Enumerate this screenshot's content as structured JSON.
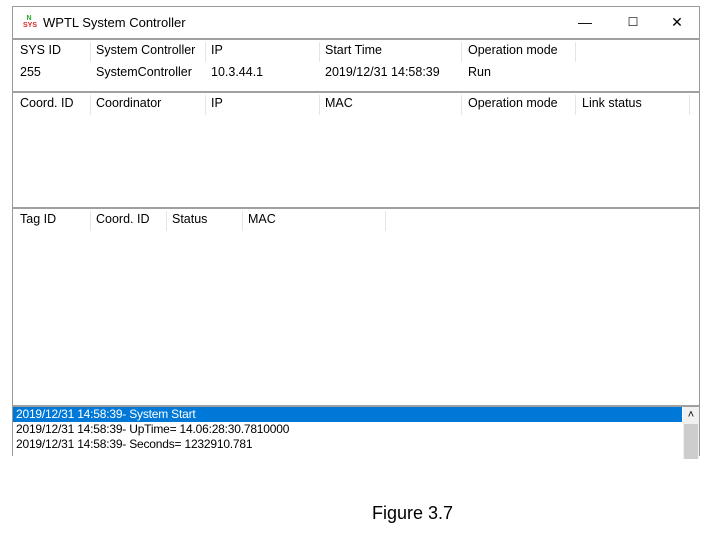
{
  "window": {
    "title": "WPTL System Controller",
    "minimize": "—",
    "maximize": "☐",
    "close": "✕"
  },
  "system": {
    "headers": [
      "SYS ID",
      "System Controller",
      "IP",
      "Start Time",
      "Operation mode"
    ],
    "values": [
      "255",
      "SystemController",
      "10.3.44.1",
      "2019/12/31 14:58:39",
      "Run"
    ]
  },
  "coordinators": {
    "headers": [
      "Coord. ID",
      "Coordinator",
      "IP",
      "MAC",
      "Operation mode",
      "Link status"
    ]
  },
  "tags": {
    "headers": [
      "Tag ID",
      "Coord. ID",
      "Status",
      "MAC"
    ]
  },
  "log": [
    "2019/12/31 14:58:39- System Start",
    "2019/12/31 14:58:39- UpTime= 14.06:28:30.7810000",
    "2019/12/31 14:58:39- Seconds= 1232910.781"
  ],
  "scroll_up": "˄",
  "caption": "Figure 3.7"
}
